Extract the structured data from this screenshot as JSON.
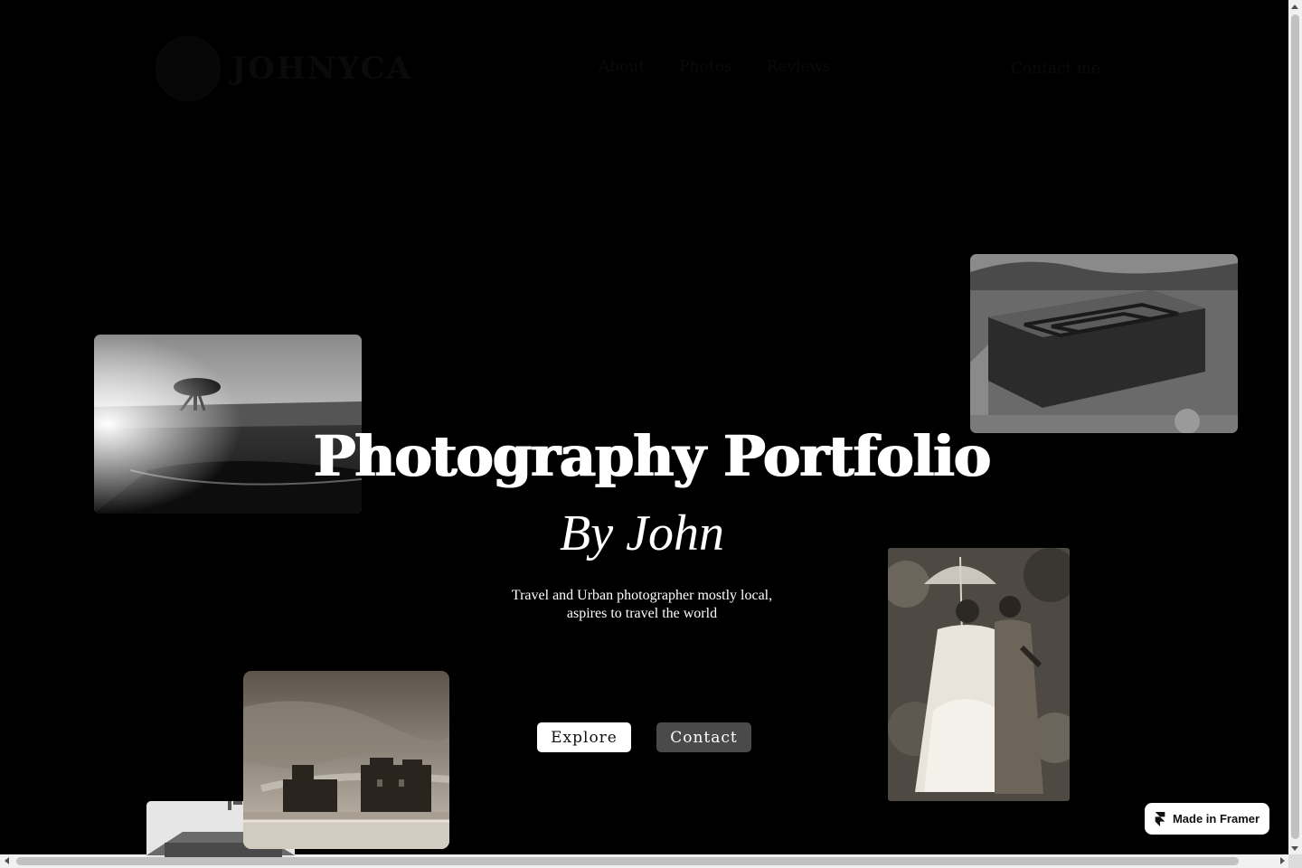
{
  "header": {
    "logo_text": "JOHNYCA",
    "nav": [
      "About",
      "Photos",
      "Reviews"
    ],
    "cta": "Contact me"
  },
  "hero": {
    "title": "Photography Portfolio",
    "subtitle": "By John",
    "description_lines": [
      "Travel and Urban photographer mostly local,",
      "aspires to travel the world"
    ],
    "buttons": {
      "explore": "Explore",
      "contact": "Contact"
    }
  },
  "photos": [
    {
      "name": "landscape-tree-photo",
      "subject": "tree on plain at sunset, black and white"
    },
    {
      "name": "rock-church-photo",
      "subject": "cross-shaped rock-hewn church seen from above"
    },
    {
      "name": "two-women-photo",
      "subject": "two women in gowns with parasol, sepia"
    },
    {
      "name": "castle-photo",
      "subject": "stone castle under cloudy sky, sepia"
    },
    {
      "name": "building-photo",
      "subject": "building rooftop, black and white"
    }
  ],
  "badge": {
    "label": "Made in Framer",
    "icon": "framer-icon"
  },
  "colors": {
    "background": "#000000",
    "text": "#ffffff",
    "explore_bg": "#ffffff",
    "contact_bg": "#4a4a4a"
  }
}
